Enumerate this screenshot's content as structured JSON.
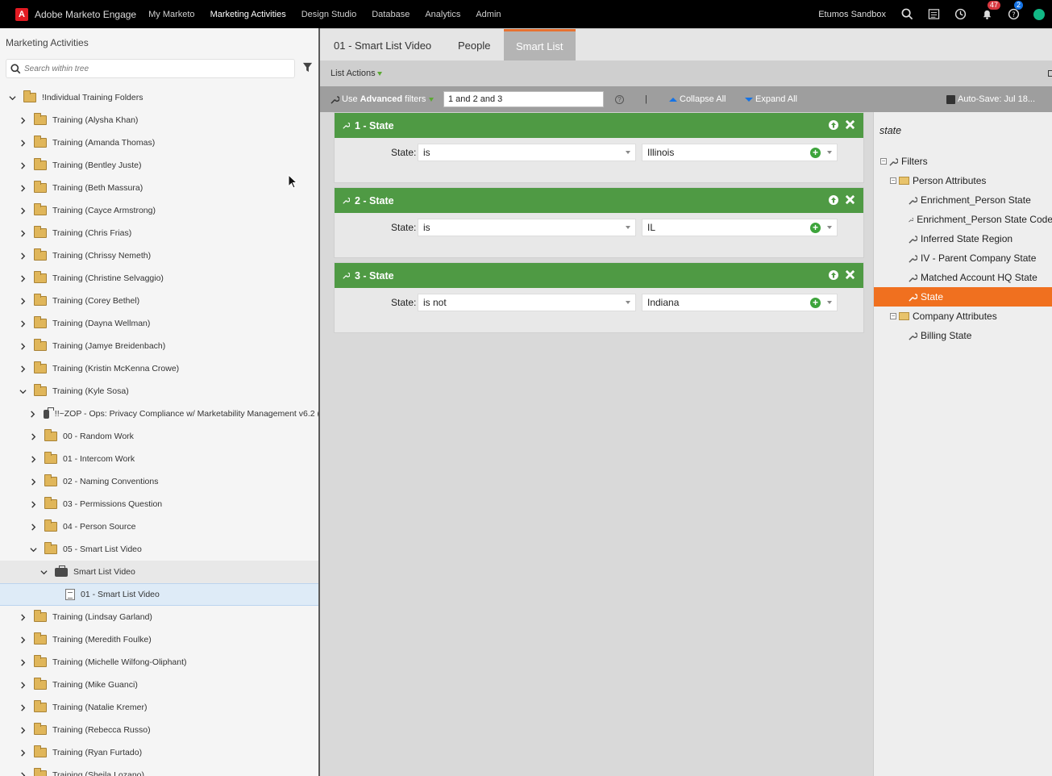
{
  "topnav": {
    "logo": "A",
    "brand": "Adobe Marketo Engage",
    "items": [
      "My Marketo",
      "Marketing Activities",
      "Design Studio",
      "Database",
      "Analytics",
      "Admin"
    ],
    "active": "Marketing Activities",
    "environment": "Etumos Sandbox",
    "notifications_count": "47",
    "help_count": "2"
  },
  "left_panel": {
    "title": "Marketing Activities",
    "search_placeholder": "Search within tree",
    "tree": [
      {
        "label": "!Individual Training Folders",
        "level": 0,
        "expanded": true,
        "type": "folder"
      },
      {
        "label": "Training (Alysha Khan)",
        "level": 1,
        "type": "folder"
      },
      {
        "label": "Training (Amanda Thomas)",
        "level": 1,
        "type": "folder"
      },
      {
        "label": "Training (Bentley Juste)",
        "level": 1,
        "type": "folder"
      },
      {
        "label": "Training (Beth Massura)",
        "level": 1,
        "type": "folder"
      },
      {
        "label": "Training (Cayce Armstrong)",
        "level": 1,
        "type": "folder"
      },
      {
        "label": "Training (Chris Frias)",
        "level": 1,
        "type": "folder"
      },
      {
        "label": "Training (Chrissy Nemeth)",
        "level": 1,
        "type": "folder"
      },
      {
        "label": "Training (Christine Selvaggio)",
        "level": 1,
        "type": "folder"
      },
      {
        "label": "Training (Corey Bethel)",
        "level": 1,
        "type": "folder"
      },
      {
        "label": "Training (Dayna Wellman)",
        "level": 1,
        "type": "folder"
      },
      {
        "label": "Training (Jamye Breidenbach)",
        "level": 1,
        "type": "folder"
      },
      {
        "label": "Training (Kristin McKenna Crowe)",
        "level": 1,
        "type": "folder"
      },
      {
        "label": "Training (Kyle Sosa)",
        "level": 1,
        "expanded": true,
        "type": "folder"
      },
      {
        "label": "!!~ZOP - Ops: Privacy Compliance w/ Marketability Management v6.2 (",
        "level": 2,
        "type": "program"
      },
      {
        "label": "00 - Random Work",
        "level": 2,
        "type": "folder"
      },
      {
        "label": "01 - Intercom Work",
        "level": 2,
        "type": "folder"
      },
      {
        "label": "02 - Naming Conventions",
        "level": 2,
        "type": "folder"
      },
      {
        "label": "03 - Permissions Question",
        "level": 2,
        "type": "folder"
      },
      {
        "label": "04 - Person Source",
        "level": 2,
        "type": "folder"
      },
      {
        "label": "05 - Smart List Video",
        "level": 2,
        "expanded": true,
        "type": "folder"
      },
      {
        "label": "Smart List Video",
        "level": 3,
        "expanded": true,
        "type": "program",
        "hover": true
      },
      {
        "label": "01 - Smart List Video",
        "level": 4,
        "type": "list",
        "selected": true
      },
      {
        "label": "Training (Lindsay Garland)",
        "level": 1,
        "type": "folder"
      },
      {
        "label": "Training (Meredith Foulke)",
        "level": 1,
        "type": "folder"
      },
      {
        "label": "Training (Michelle Wilfong-Oliphant)",
        "level": 1,
        "type": "folder"
      },
      {
        "label": "Training (Mike Guanci)",
        "level": 1,
        "type": "folder"
      },
      {
        "label": "Training (Natalie Kremer)",
        "level": 1,
        "type": "folder"
      },
      {
        "label": "Training (Rebecca Russo)",
        "level": 1,
        "type": "folder"
      },
      {
        "label": "Training (Ryan Furtado)",
        "level": 1,
        "type": "folder"
      },
      {
        "label": "Training (Sheila Lozano)",
        "level": 1,
        "type": "folder"
      }
    ]
  },
  "tabs": [
    {
      "label": "01 - Smart List Video",
      "active": false
    },
    {
      "label": "People",
      "active": false
    },
    {
      "label": "Smart List",
      "active": true
    }
  ],
  "actionbar": {
    "list_actions": "List Actions"
  },
  "toolbar": {
    "use_label": "Use",
    "advanced_label": "Advanced",
    "filters_label": "filters",
    "rule_logic": "1 and 2 and 3",
    "divider": "|",
    "collapse_all": "Collapse All",
    "expand_all": "Expand All",
    "autosave": "Auto-Save: Jul 18..."
  },
  "filters": [
    {
      "title": "1 - State",
      "field_label": "State:",
      "operator": "is",
      "value": "Illinois"
    },
    {
      "title": "2 - State",
      "field_label": "State:",
      "operator": "is",
      "value": "IL"
    },
    {
      "title": "3 - State",
      "field_label": "State:",
      "operator": "is not",
      "value": "Indiana"
    }
  ],
  "side_panel": {
    "search_text": "state",
    "root": "Filters",
    "groups": [
      {
        "label": "Person Attributes",
        "items": [
          "Enrichment_Person State",
          "Enrichment_Person State Code",
          "Inferred State Region",
          "IV - Parent Company State",
          "Matched Account HQ State",
          "State"
        ]
      },
      {
        "label": "Company Attributes",
        "items": [
          "Billing State"
        ]
      }
    ],
    "selected": "State"
  },
  "colors": {
    "accent_orange": "#f0701f",
    "filter_green": "#4f9a44",
    "nav_bg": "#000000"
  }
}
